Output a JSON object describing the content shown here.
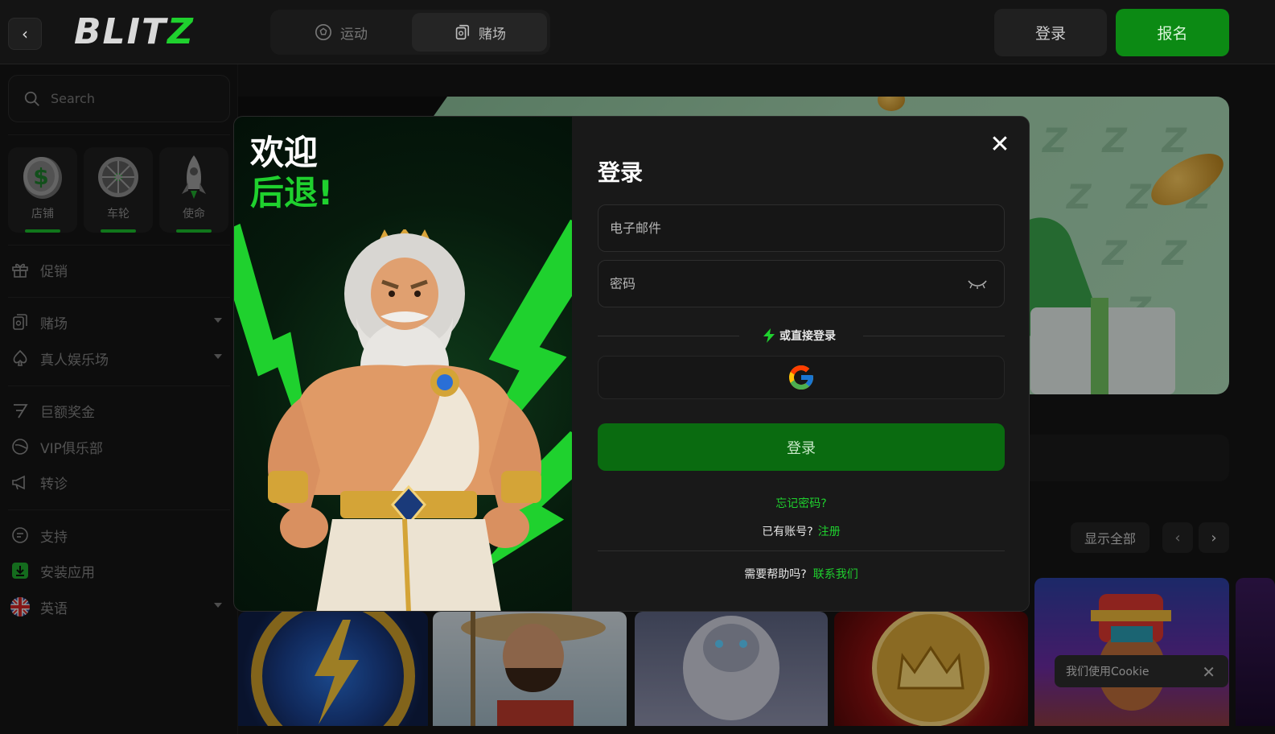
{
  "header": {
    "logo_main": "BLIT",
    "logo_accent": "Z",
    "tabs": [
      {
        "label": "运动",
        "icon": "soccer-ball-icon"
      },
      {
        "label": "赌场",
        "icon": "cards-icon"
      }
    ],
    "login_label": "登录",
    "signup_label": "报名"
  },
  "sidebar": {
    "search_placeholder": "Search",
    "quick_links": [
      {
        "label": "店铺",
        "icon": "dollar-coin-icon"
      },
      {
        "label": "车轮",
        "icon": "wheel-icon"
      },
      {
        "label": "使命",
        "icon": "rocket-icon"
      }
    ],
    "items": [
      {
        "label": "促销",
        "icon": "gift-icon"
      },
      {
        "label": "赌场",
        "icon": "cards-icon"
      },
      {
        "label": "真人娱乐场",
        "icon": "spade-icon"
      },
      {
        "label": "巨额奖金",
        "icon": "seven-icon"
      },
      {
        "label": "VIP俱乐部",
        "icon": "vip-icon"
      },
      {
        "label": "转诊",
        "icon": "megaphone-icon"
      },
      {
        "label": "支持",
        "icon": "chat-icon"
      },
      {
        "label": "安装应用",
        "icon": "download-icon"
      },
      {
        "label": "英语",
        "icon": "uk-flag-icon"
      }
    ]
  },
  "main": {
    "show_all_label": "显示全部",
    "cookie_text": "我们使用Cookie"
  },
  "modal": {
    "welcome_line1": "欢迎",
    "welcome_line2": "后退!",
    "title": "登录",
    "email_placeholder": "电子邮件",
    "password_placeholder": "密码",
    "or_text": "或直接登录",
    "submit_label": "登录",
    "forgot_label": "忘记密码?",
    "have_account_text": "已有账号?",
    "register_link": "注册",
    "help_text": "需要帮助吗?",
    "contact_link": "联系我们"
  },
  "colors": {
    "accent_green": "#1fd12e",
    "button_green": "#0a6b10",
    "background": "#151515"
  }
}
